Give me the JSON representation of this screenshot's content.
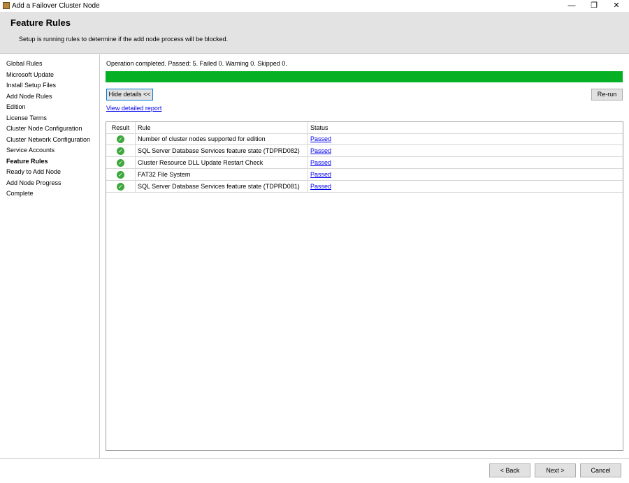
{
  "window": {
    "title": "Add a Failover Cluster Node",
    "controls": {
      "minimize": "—",
      "restore": "❐",
      "close": "✕"
    }
  },
  "header": {
    "title": "Feature Rules",
    "subtitle": "Setup is running rules to determine if the add node process will be blocked."
  },
  "nav": {
    "items": [
      {
        "label": "Global Rules"
      },
      {
        "label": "Microsoft Update"
      },
      {
        "label": "Install Setup Files"
      },
      {
        "label": "Add Node Rules"
      },
      {
        "label": "Edition"
      },
      {
        "label": "License Terms"
      },
      {
        "label": "Cluster Node Configuration"
      },
      {
        "label": "Cluster Network Configuration"
      },
      {
        "label": "Service Accounts"
      },
      {
        "label": "Feature Rules",
        "active": true
      },
      {
        "label": "Ready to Add Node"
      },
      {
        "label": "Add Node Progress"
      },
      {
        "label": "Complete"
      }
    ]
  },
  "main": {
    "status": "Operation completed. Passed: 5.   Failed 0.   Warning 0.   Skipped 0.",
    "progress_percent": 100,
    "progress_color": "#06b025",
    "hide_details": "Hide details <<",
    "rerun": "Re-run",
    "report_link": "View detailed report",
    "table": {
      "headers": [
        "Result",
        "Rule",
        "Status"
      ],
      "rows": [
        {
          "icon": "check-circle-icon",
          "rule": "Number of cluster nodes supported for edition",
          "status": "Passed"
        },
        {
          "icon": "check-circle-icon",
          "rule": "SQL Server Database Services feature state (TDPRD082)",
          "status": "Passed"
        },
        {
          "icon": "check-circle-icon",
          "rule": "Cluster Resource DLL Update Restart Check",
          "status": "Passed"
        },
        {
          "icon": "check-circle-icon",
          "rule": "FAT32 File System",
          "status": "Passed"
        },
        {
          "icon": "check-circle-icon",
          "rule": "SQL Server Database Services feature state (TDPRD081)",
          "status": "Passed"
        }
      ]
    }
  },
  "footer": {
    "back": "< Back",
    "next": "Next >",
    "cancel": "Cancel"
  }
}
